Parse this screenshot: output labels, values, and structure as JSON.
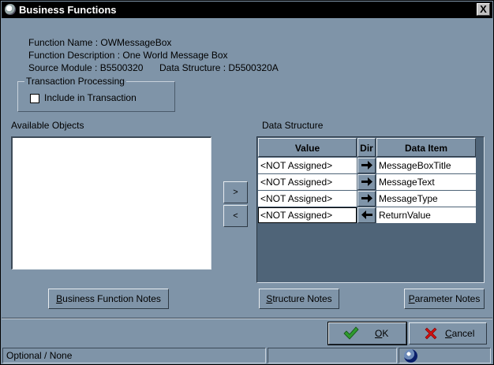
{
  "window": {
    "title": "Business Functions",
    "close_glyph": "X"
  },
  "info": {
    "function_name": "Function Name : OWMessageBox",
    "function_description": "Function Description : One World Message Box",
    "source_module": "Source Module : B5500320",
    "data_structure": "Data Structure : D5500320A"
  },
  "transaction": {
    "group_title": "Transaction Processing",
    "include_label": "Include in Transaction",
    "include_checked": false
  },
  "available_objects": {
    "label": "Available Objects",
    "items": []
  },
  "move_buttons": {
    "add": ">",
    "remove": "<"
  },
  "data_structure": {
    "label": "Data Structure",
    "columns": [
      "Value",
      "Dir",
      "Data Item"
    ],
    "rows": [
      {
        "value": "<NOT Assigned>",
        "dir": "right-arrow-icon",
        "item": "MessageBoxTitle"
      },
      {
        "value": "<NOT Assigned>",
        "dir": "right-arrow-icon",
        "item": "MessageText"
      },
      {
        "value": "<NOT Assigned>",
        "dir": "right-arrow-icon",
        "item": "MessageType"
      },
      {
        "value": "<NOT Assigned>",
        "dir": "left-arrow-icon",
        "item": "ReturnValue"
      }
    ]
  },
  "buttons": {
    "bf_notes": {
      "mnemonic": "B",
      "rest": "usiness Function Notes"
    },
    "structure_notes": {
      "mnemonic": "S",
      "rest": "tructure Notes"
    },
    "parameter_notes": {
      "mnemonic": "P",
      "rest": "arameter Notes"
    },
    "ok": {
      "mnemonic": "O",
      "rest": "K"
    },
    "cancel": {
      "mnemonic": "C",
      "rest": "ancel"
    }
  },
  "status": {
    "text": "Optional / None"
  },
  "colors": {
    "background": "#7f94a8",
    "grid_background": "#4f6478",
    "ok_check": "#2e9a2e",
    "cancel_x": "#d01010"
  }
}
